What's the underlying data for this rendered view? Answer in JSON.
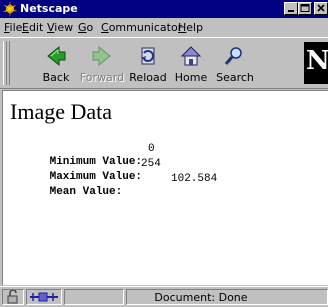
{
  "window": {
    "title": "Netscape"
  },
  "menu": [
    "File",
    "Edit",
    "View",
    "Go",
    "Communicator",
    "Help"
  ],
  "menu_mnemonics": [
    "F",
    "E",
    "V",
    "G",
    "C",
    "H"
  ],
  "toolbar": {
    "back": "Back",
    "forward": "Forward",
    "reload": "Reload",
    "home": "Home",
    "search": "Search",
    "logo": "N"
  },
  "page": {
    "title": "Image Data",
    "rows": [
      {
        "label": "Minimum Value:",
        "value": "0"
      },
      {
        "label": "Maximum Value:",
        "value": "254"
      },
      {
        "label": "Mean Value:",
        "value": "102.584"
      }
    ]
  },
  "status": {
    "text": "Document: Done"
  },
  "icons": {
    "app": "netscape-meteor-icon",
    "minimize": "minimize-icon",
    "maximize": "maximize-icon",
    "close": "close-icon",
    "back": "back-arrow-icon",
    "forward": "forward-arrow-icon",
    "reload": "reload-icon",
    "home": "home-icon",
    "search": "search-icon",
    "security": "lock-icon",
    "connection": "connection-icon"
  },
  "colors": {
    "titlebar": "#000080",
    "chrome": "#c0c0c0",
    "content": "#ffffff"
  }
}
